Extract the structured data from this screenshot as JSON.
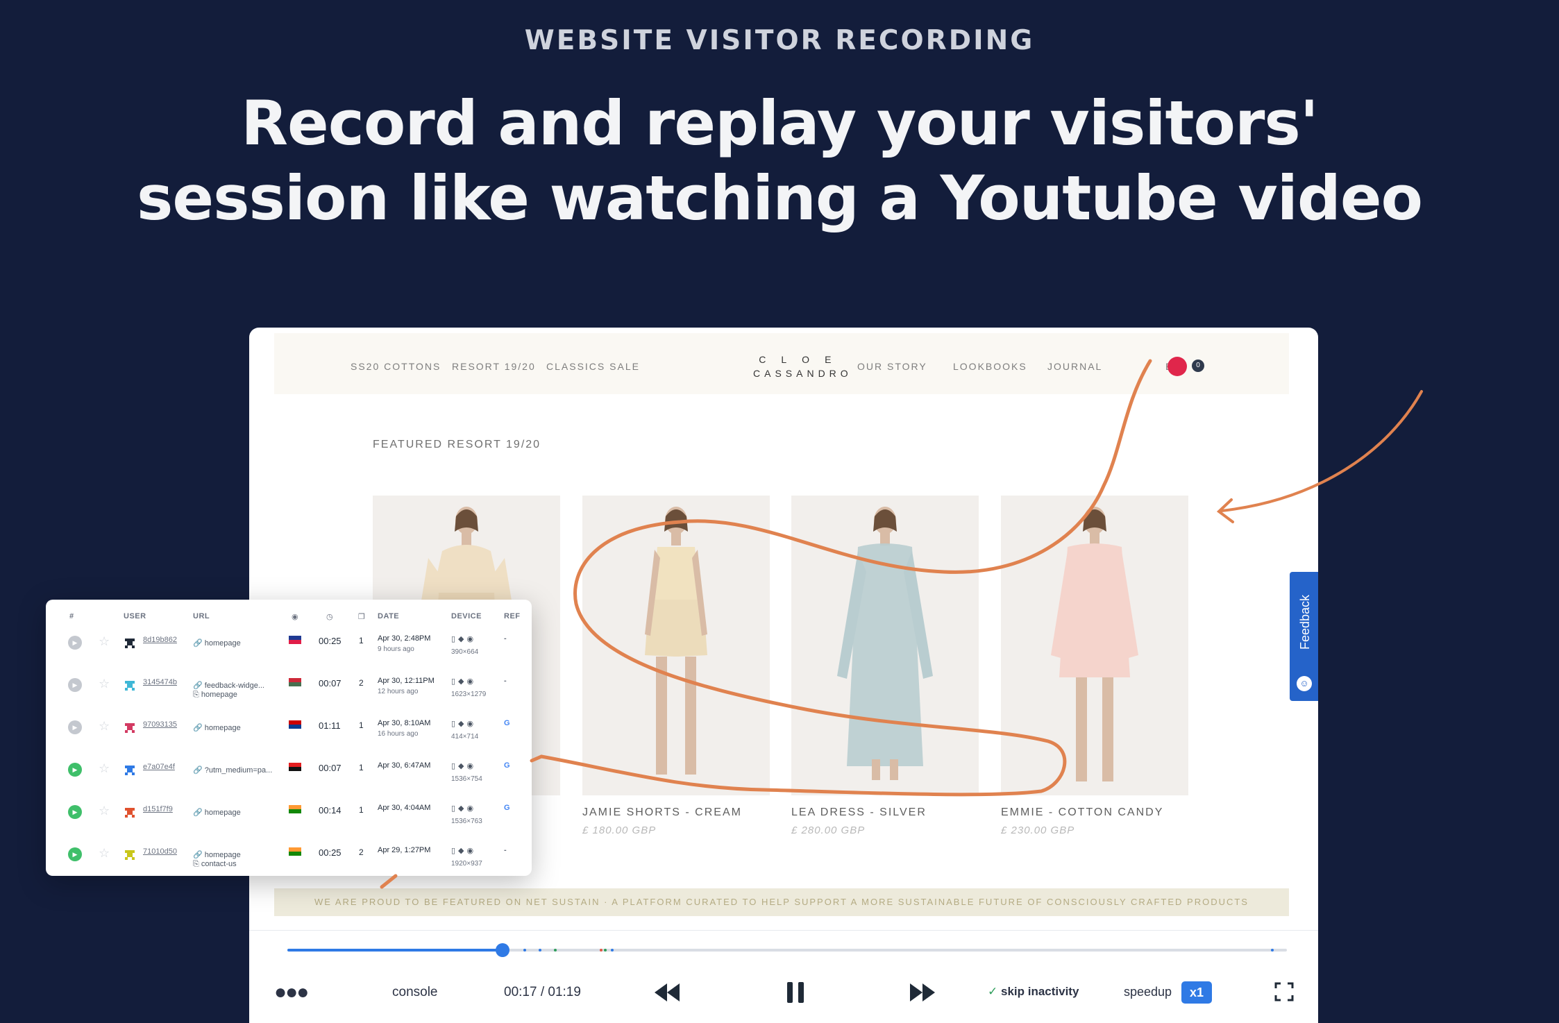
{
  "hero": {
    "eyebrow": "WEBSITE VISITOR RECORDING",
    "headline_line1": "Record and replay your visitors'",
    "headline_line2": "session like watching a Youtube video"
  },
  "site": {
    "nav_left": [
      "SS20 COTTONS",
      "RESORT 19/20",
      "CLASSICS SALE"
    ],
    "logo_line1": "CLOE",
    "logo_line2": "CASSANDRO",
    "nav_right": [
      "OUR STORY",
      "LOOKBOOKS",
      "JOURNAL"
    ],
    "cart_label": "B",
    "cart_count": "0",
    "featured_label": "FEATURED RESORT 19/20",
    "products": [
      {
        "name": "",
        "price": ""
      },
      {
        "name": "JAMIE SHORTS - CREAM",
        "price": "£ 180.00 GBP"
      },
      {
        "name": "LEA DRESS - SILVER",
        "price": "£ 280.00 GBP"
      },
      {
        "name": "EMMIE - COTTON CANDY",
        "price": "£ 230.00 GBP"
      }
    ],
    "banner": "WE ARE PROUD TO BE FEATURED ON NET SUSTAIN · A PLATFORM CURATED TO HELP SUPPORT A MORE SUSTAINABLE FUTURE OF CONSCIOUSLY CRAFTED PRODUCTS",
    "feedback_label": "Feedback"
  },
  "player": {
    "progress": 0.215,
    "more_icon": "ellipsis-icon",
    "console_label": "console",
    "time_current": "00:17",
    "time_total": "01:19",
    "skip_label": "skip inactivity",
    "speed_label": "speedup",
    "speed_value": "x1",
    "accent": "#2f7ae5"
  },
  "sessions": {
    "headers": {
      "num": "#",
      "user": "USER",
      "url": "URL",
      "date": "DATE",
      "device": "DEVICE",
      "ref": "REF"
    },
    "rows": [
      {
        "played": false,
        "uid": "8d19b862",
        "url1": "homepage",
        "url2": "",
        "flag": "NZ",
        "duration": "00:25",
        "pages": "1",
        "date": "Apr 30, 2:48PM",
        "ago": "9 hours ago",
        "res": "390×664",
        "ref": "-"
      },
      {
        "played": false,
        "uid": "3145474b",
        "url1": "feedback-widge...",
        "url2": "homepage",
        "flag": "HU",
        "duration": "00:07",
        "pages": "2",
        "date": "Apr 30, 12:11PM",
        "ago": "12 hours ago",
        "res": "1623×1279",
        "ref": "-"
      },
      {
        "played": false,
        "uid": "97093135",
        "url1": "homepage",
        "url2": "",
        "flag": "MY",
        "duration": "01:11",
        "pages": "1",
        "date": "Apr 30, 8:10AM",
        "ago": "16 hours ago",
        "res": "414×714",
        "ref": "G"
      },
      {
        "played": true,
        "uid": "e7a07e4f",
        "url1": "?utm_medium=pa...",
        "url2": "",
        "flag": "AL",
        "duration": "00:07",
        "pages": "1",
        "date": "Apr 30, 6:47AM",
        "ago": "",
        "res": "1536×754",
        "ref": "G"
      },
      {
        "played": true,
        "uid": "d151f7f9",
        "url1": "homepage",
        "url2": "",
        "flag": "IN",
        "duration": "00:14",
        "pages": "1",
        "date": "Apr 30, 4:04AM",
        "ago": "",
        "res": "1536×763",
        "ref": "G"
      },
      {
        "played": true,
        "uid": "71010d50",
        "url1": "homepage",
        "url2": "contact-us",
        "flag": "IN",
        "duration": "00:25",
        "pages": "2",
        "date": "Apr 29, 1:27PM",
        "ago": "",
        "res": "1920×937",
        "ref": "-"
      }
    ]
  }
}
